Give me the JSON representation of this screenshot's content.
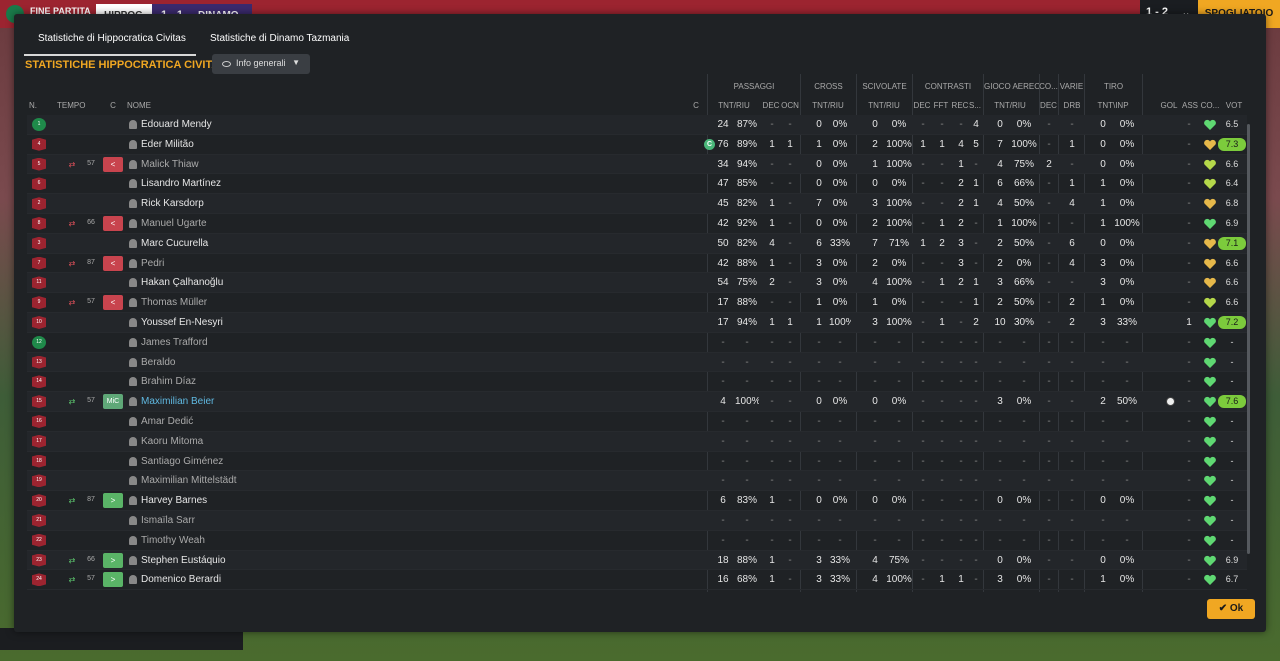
{
  "topbar": {
    "status": "FINE PARTITA",
    "home_team": "HIPPOC",
    "score": "1 - 1",
    "away_team": "DINAMO",
    "right_score": "1 - 2",
    "button_label": "SPOGLIATOIO"
  },
  "tabs": [
    {
      "label": "Statistiche di Hippocratica Civitas",
      "active": true
    },
    {
      "label": "Statistiche di Dinamo Tazmania",
      "active": false
    }
  ],
  "section_title": "STATISTICHE HIPPOCRATICA CIVITAS",
  "view_dropdown": {
    "label": "Info generali"
  },
  "groups": {
    "passaggi": "PASSAGGI",
    "cross": "CROSS",
    "scivolate": "SCIVOLATE",
    "contrasti": "CONTRASTI",
    "gioco_aereo": "GIOCO AEREO",
    "co": "CO...",
    "varie": "VARIE",
    "tiro": "TIRO"
  },
  "headers": {
    "n": "N.",
    "tempo": "TEMPO",
    "c": "C",
    "nome": "NOME",
    "c2": "C",
    "pass_tnt": "TNT/RIU",
    "pass_dec": "DEC",
    "pass_ocn": "OCN",
    "cross_tnt": "TNT/RIU",
    "sciv_tnt": "TNT/RIU",
    "con_dec": "DEC",
    "con_fft": "FFT",
    "con_rec": "REC",
    "con_s": "S...",
    "aer_tnt": "TNT/RIU",
    "co_dec": "DEC",
    "var_drb": "DRB",
    "tiro_tnt": "TNT\\INP",
    "gol": "GOL",
    "ass": "ASS",
    "cond": "CO...",
    "vot": "VOT"
  },
  "players": [
    {
      "num": "1",
      "gk": true,
      "name": "Édouard Mendy",
      "pass": [
        "24",
        "87%"
      ],
      "pdec": "-",
      "pocn": "-",
      "cross": [
        "0",
        "0%"
      ],
      "sciv": [
        "0",
        "0%"
      ],
      "con": [
        "-",
        "-",
        "-",
        "4"
      ],
      "aer": [
        "0",
        "0%"
      ],
      "codec": "-",
      "drb": "-",
      "tiro": [
        "0",
        "0%"
      ],
      "gol": "",
      "ass": "-",
      "vot": "6.5",
      "hi": false
    },
    {
      "num": "4",
      "name": "Éder Militão",
      "captain": "C",
      "pass": [
        "76",
        "89%"
      ],
      "pdec": "1",
      "pocn": "1",
      "cross": [
        "1",
        "0%"
      ],
      "sciv": [
        "2",
        "100%"
      ],
      "con": [
        "1",
        "1",
        "4",
        "5"
      ],
      "aer": [
        "7",
        "100%"
      ],
      "codec": "-",
      "drb": "1",
      "tiro": [
        "0",
        "0%"
      ],
      "gol": "",
      "ass": "-",
      "vot": "7.3",
      "hi": true
    },
    {
      "num": "5",
      "sub": "out",
      "mins": "57",
      "tag": "<",
      "name": "Malick Thiaw",
      "pass": [
        "34",
        "94%"
      ],
      "pdec": "-",
      "pocn": "-",
      "cross": [
        "0",
        "0%"
      ],
      "sciv": [
        "1",
        "100%"
      ],
      "con": [
        "-",
        "-",
        "1",
        "-"
      ],
      "aer": [
        "4",
        "75%"
      ],
      "codec": "2",
      "drb": "-",
      "tiro": [
        "0",
        "0%"
      ],
      "gol": "",
      "ass": "-",
      "vot": "6.6",
      "hi": false
    },
    {
      "num": "6",
      "name": "Lisandro Martínez",
      "pass": [
        "47",
        "85%"
      ],
      "pdec": "-",
      "pocn": "-",
      "cross": [
        "0",
        "0%"
      ],
      "sciv": [
        "0",
        "0%"
      ],
      "con": [
        "-",
        "-",
        "2",
        "1"
      ],
      "aer": [
        "6",
        "66%"
      ],
      "codec": "-",
      "drb": "1",
      "tiro": [
        "1",
        "0%"
      ],
      "gol": "",
      "ass": "-",
      "vot": "6.4",
      "hi": false
    },
    {
      "num": "2",
      "name": "Rick Karsdorp",
      "pass": [
        "45",
        "82%"
      ],
      "pdec": "1",
      "pocn": "-",
      "cross": [
        "7",
        "0%"
      ],
      "sciv": [
        "3",
        "100%"
      ],
      "con": [
        "-",
        "-",
        "2",
        "1"
      ],
      "aer": [
        "4",
        "50%"
      ],
      "codec": "-",
      "drb": "4",
      "tiro": [
        "1",
        "0%"
      ],
      "gol": "",
      "ass": "-",
      "vot": "6.8",
      "hi": false
    },
    {
      "num": "8",
      "sub": "out",
      "mins": "66",
      "tag": "<",
      "name": "Manuel Ugarte",
      "pass": [
        "42",
        "92%"
      ],
      "pdec": "1",
      "pocn": "-",
      "cross": [
        "0",
        "0%"
      ],
      "sciv": [
        "2",
        "100%"
      ],
      "con": [
        "-",
        "1",
        "2",
        "-"
      ],
      "aer": [
        "1",
        "100%"
      ],
      "codec": "-",
      "drb": "-",
      "tiro": [
        "1",
        "100%"
      ],
      "gol": "",
      "ass": "-",
      "vot": "6.9",
      "hi": false
    },
    {
      "num": "3",
      "name": "Marc Cucurella",
      "pass": [
        "50",
        "82%"
      ],
      "pdec": "4",
      "pocn": "-",
      "cross": [
        "6",
        "33%"
      ],
      "sciv": [
        "7",
        "71%"
      ],
      "con": [
        "1",
        "2",
        "3",
        "-"
      ],
      "aer": [
        "2",
        "50%"
      ],
      "codec": "-",
      "drb": "6",
      "tiro": [
        "0",
        "0%"
      ],
      "gol": "",
      "ass": "-",
      "vot": "7.1",
      "hi": true
    },
    {
      "num": "7",
      "sub": "out",
      "mins": "87",
      "tag": "<",
      "name": "Pedri",
      "pass": [
        "42",
        "88%"
      ],
      "pdec": "1",
      "pocn": "-",
      "cross": [
        "3",
        "0%"
      ],
      "sciv": [
        "2",
        "0%"
      ],
      "con": [
        "-",
        "-",
        "3",
        "-"
      ],
      "aer": [
        "2",
        "0%"
      ],
      "codec": "-",
      "drb": "4",
      "tiro": [
        "3",
        "0%"
      ],
      "gol": "",
      "ass": "-",
      "vot": "6.6",
      "hi": false
    },
    {
      "num": "11",
      "name": "Hakan Çalhanoğlu",
      "pass": [
        "54",
        "75%"
      ],
      "pdec": "2",
      "pocn": "-",
      "cross": [
        "3",
        "0%"
      ],
      "sciv": [
        "4",
        "100%"
      ],
      "con": [
        "-",
        "1",
        "2",
        "1"
      ],
      "aer": [
        "3",
        "66%"
      ],
      "codec": "-",
      "drb": "-",
      "tiro": [
        "3",
        "0%"
      ],
      "gol": "",
      "ass": "-",
      "vot": "6.6",
      "hi": false
    },
    {
      "num": "9",
      "sub": "out",
      "mins": "57",
      "tag": "<",
      "name": "Thomas Müller",
      "pass": [
        "17",
        "88%"
      ],
      "pdec": "-",
      "pocn": "-",
      "cross": [
        "1",
        "0%"
      ],
      "sciv": [
        "1",
        "0%"
      ],
      "con": [
        "-",
        "-",
        "-",
        "1"
      ],
      "aer": [
        "2",
        "50%"
      ],
      "codec": "-",
      "drb": "2",
      "tiro": [
        "1",
        "0%"
      ],
      "gol": "",
      "ass": "-",
      "vot": "6.6",
      "hi": false
    },
    {
      "num": "10",
      "name": "Youssef En-Nesyri",
      "pass": [
        "17",
        "94%"
      ],
      "pdec": "1",
      "pocn": "1",
      "cross": [
        "1",
        "100%"
      ],
      "sciv": [
        "3",
        "100%"
      ],
      "con": [
        "-",
        "1",
        "-",
        "2"
      ],
      "aer": [
        "10",
        "30%"
      ],
      "codec": "-",
      "drb": "2",
      "tiro": [
        "3",
        "33%"
      ],
      "gol": "",
      "ass": "1",
      "vot": "7.2",
      "hi": true
    },
    {
      "num": "12",
      "gk": true,
      "name": "James Trafford",
      "bench": true,
      "pass": [
        "-",
        "-"
      ],
      "pdec": "-",
      "pocn": "-",
      "cross": [
        "-",
        "-"
      ],
      "sciv": [
        "-",
        "-"
      ],
      "con": [
        "-",
        "-",
        "-",
        "-"
      ],
      "aer": [
        "-",
        "-"
      ],
      "codec": "-",
      "drb": "-",
      "tiro": [
        "-",
        "-"
      ],
      "gol": "",
      "ass": "-",
      "vot": "-",
      "hi": false
    },
    {
      "num": "13",
      "name": "Beraldo",
      "bench": true,
      "pass": [
        "-",
        "-"
      ],
      "pdec": "-",
      "pocn": "-",
      "cross": [
        "-",
        "-"
      ],
      "sciv": [
        "-",
        "-"
      ],
      "con": [
        "-",
        "-",
        "-",
        "-"
      ],
      "aer": [
        "-",
        "-"
      ],
      "codec": "-",
      "drb": "-",
      "tiro": [
        "-",
        "-"
      ],
      "gol": "",
      "ass": "-",
      "vot": "-",
      "hi": false
    },
    {
      "num": "14",
      "name": "Brahim Díaz",
      "bench": true,
      "pass": [
        "-",
        "-"
      ],
      "pdec": "-",
      "pocn": "-",
      "cross": [
        "-",
        "-"
      ],
      "sciv": [
        "-",
        "-"
      ],
      "con": [
        "-",
        "-",
        "-",
        "-"
      ],
      "aer": [
        "-",
        "-"
      ],
      "codec": "-",
      "drb": "-",
      "tiro": [
        "-",
        "-"
      ],
      "gol": "",
      "ass": "-",
      "vot": "-",
      "hi": false
    },
    {
      "num": "15",
      "sub": "in",
      "mins": "57",
      "tag": "MiC",
      "active": true,
      "name": "Maximilian Beier",
      "pass": [
        "4",
        "100%"
      ],
      "pdec": "-",
      "pocn": "-",
      "cross": [
        "0",
        "0%"
      ],
      "sciv": [
        "0",
        "0%"
      ],
      "con": [
        "-",
        "-",
        "-",
        "-"
      ],
      "aer": [
        "3",
        "0%"
      ],
      "codec": "-",
      "drb": "-",
      "tiro": [
        "2",
        "50%"
      ],
      "gol": "ball",
      "ass": "-",
      "vot": "7.6",
      "hi": true
    },
    {
      "num": "16",
      "name": "Amar Dedić",
      "bench": true,
      "pass": [
        "-",
        "-"
      ],
      "pdec": "-",
      "pocn": "-",
      "cross": [
        "-",
        "-"
      ],
      "sciv": [
        "-",
        "-"
      ],
      "con": [
        "-",
        "-",
        "-",
        "-"
      ],
      "aer": [
        "-",
        "-"
      ],
      "codec": "-",
      "drb": "-",
      "tiro": [
        "-",
        "-"
      ],
      "gol": "",
      "ass": "-",
      "vot": "-",
      "hi": false
    },
    {
      "num": "17",
      "name": "Kaoru Mitoma",
      "bench": true,
      "pass": [
        "-",
        "-"
      ],
      "pdec": "-",
      "pocn": "-",
      "cross": [
        "-",
        "-"
      ],
      "sciv": [
        "-",
        "-"
      ],
      "con": [
        "-",
        "-",
        "-",
        "-"
      ],
      "aer": [
        "-",
        "-"
      ],
      "codec": "-",
      "drb": "-",
      "tiro": [
        "-",
        "-"
      ],
      "gol": "",
      "ass": "-",
      "vot": "-",
      "hi": false
    },
    {
      "num": "18",
      "name": "Santiago Giménez",
      "bench": true,
      "pass": [
        "-",
        "-"
      ],
      "pdec": "-",
      "pocn": "-",
      "cross": [
        "-",
        "-"
      ],
      "sciv": [
        "-",
        "-"
      ],
      "con": [
        "-",
        "-",
        "-",
        "-"
      ],
      "aer": [
        "-",
        "-"
      ],
      "codec": "-",
      "drb": "-",
      "tiro": [
        "-",
        "-"
      ],
      "gol": "",
      "ass": "-",
      "vot": "-",
      "hi": false
    },
    {
      "num": "19",
      "name": "Maximilian Mittelstädt",
      "bench": true,
      "pass": [
        "-",
        "-"
      ],
      "pdec": "-",
      "pocn": "-",
      "cross": [
        "-",
        "-"
      ],
      "sciv": [
        "-",
        "-"
      ],
      "con": [
        "-",
        "-",
        "-",
        "-"
      ],
      "aer": [
        "-",
        "-"
      ],
      "codec": "-",
      "drb": "-",
      "tiro": [
        "-",
        "-"
      ],
      "gol": "",
      "ass": "-",
      "vot": "-",
      "hi": false
    },
    {
      "num": "20",
      "sub": "in",
      "mins": "87",
      "tag": ">",
      "name": "Harvey Barnes",
      "pass": [
        "6",
        "83%"
      ],
      "pdec": "1",
      "pocn": "-",
      "cross": [
        "0",
        "0%"
      ],
      "sciv": [
        "0",
        "0%"
      ],
      "con": [
        "-",
        "-",
        "-",
        "-"
      ],
      "aer": [
        "0",
        "0%"
      ],
      "codec": "-",
      "drb": "-",
      "tiro": [
        "0",
        "0%"
      ],
      "gol": "",
      "ass": "-",
      "vot": "-",
      "hi": false
    },
    {
      "num": "21",
      "name": "Ismaïla Sarr",
      "bench": true,
      "pass": [
        "-",
        "-"
      ],
      "pdec": "-",
      "pocn": "-",
      "cross": [
        "-",
        "-"
      ],
      "sciv": [
        "-",
        "-"
      ],
      "con": [
        "-",
        "-",
        "-",
        "-"
      ],
      "aer": [
        "-",
        "-"
      ],
      "codec": "-",
      "drb": "-",
      "tiro": [
        "-",
        "-"
      ],
      "gol": "",
      "ass": "-",
      "vot": "-",
      "hi": false
    },
    {
      "num": "22",
      "name": "Timothy Weah",
      "bench": true,
      "pass": [
        "-",
        "-"
      ],
      "pdec": "-",
      "pocn": "-",
      "cross": [
        "-",
        "-"
      ],
      "sciv": [
        "-",
        "-"
      ],
      "con": [
        "-",
        "-",
        "-",
        "-"
      ],
      "aer": [
        "-",
        "-"
      ],
      "codec": "-",
      "drb": "-",
      "tiro": [
        "-",
        "-"
      ],
      "gol": "",
      "ass": "-",
      "vot": "-",
      "hi": false
    },
    {
      "num": "23",
      "sub": "in",
      "mins": "66",
      "tag": ">",
      "name": "Stephen Eustáquio",
      "pass": [
        "18",
        "88%"
      ],
      "pdec": "1",
      "pocn": "-",
      "cross": [
        "3",
        "33%"
      ],
      "sciv": [
        "4",
        "75%"
      ],
      "con": [
        "-",
        "-",
        "-",
        "-"
      ],
      "aer": [
        "0",
        "0%"
      ],
      "codec": "-",
      "drb": "-",
      "tiro": [
        "0",
        "0%"
      ],
      "gol": "",
      "ass": "-",
      "vot": "6.9",
      "hi": false
    },
    {
      "num": "24",
      "sub": "in",
      "mins": "57",
      "tag": ">",
      "name": "Domenico Berardi",
      "pass": [
        "16",
        "68%"
      ],
      "pdec": "1",
      "pocn": "-",
      "cross": [
        "3",
        "33%"
      ],
      "sciv": [
        "4",
        "100%"
      ],
      "con": [
        "-",
        "1",
        "1",
        "-"
      ],
      "aer": [
        "3",
        "0%"
      ],
      "codec": "-",
      "drb": "-",
      "tiro": [
        "1",
        "0%"
      ],
      "gol": "",
      "ass": "-",
      "vot": "6.7",
      "hi": false
    }
  ],
  "ok_label": "Ok",
  "colors": {
    "accent": "#f0a722",
    "panel": "#1f2225",
    "rating_high": "#7ccb3c",
    "heart": "#5fd872",
    "sub_out": "#c8444e",
    "sub_in": "#5ab467"
  }
}
